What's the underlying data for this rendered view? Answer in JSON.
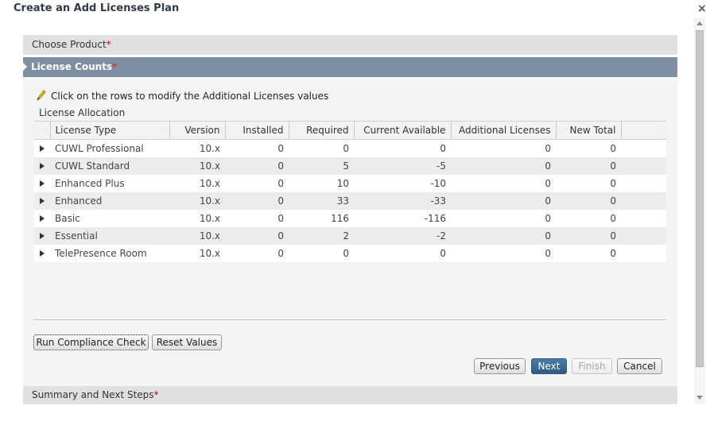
{
  "dialog": {
    "title": "Create an Add Licenses Plan",
    "close_label": "×"
  },
  "sections": {
    "choose_product": "Choose Product",
    "license_counts": "License Counts",
    "summary": "Summary and Next Steps",
    "required_marker": "*"
  },
  "panel": {
    "hint": "Click on the rows to modify the Additional Licenses values",
    "allocation_title": "License Allocation"
  },
  "table": {
    "columns": [
      "License Type",
      "Version",
      "Installed",
      "Required",
      "Current Available",
      "Additional Licenses",
      "New Total"
    ],
    "rows": [
      {
        "type": "CUWL Professional",
        "version": "10.x",
        "installed": "0",
        "required": "0",
        "available": "0",
        "additional": "0",
        "total": "0"
      },
      {
        "type": "CUWL Standard",
        "version": "10.x",
        "installed": "0",
        "required": "5",
        "available": "-5",
        "additional": "0",
        "total": "0"
      },
      {
        "type": "Enhanced Plus",
        "version": "10.x",
        "installed": "0",
        "required": "10",
        "available": "-10",
        "additional": "0",
        "total": "0"
      },
      {
        "type": "Enhanced",
        "version": "10.x",
        "installed": "0",
        "required": "33",
        "available": "-33",
        "additional": "0",
        "total": "0"
      },
      {
        "type": "Basic",
        "version": "10.x",
        "installed": "0",
        "required": "116",
        "available": "-116",
        "additional": "0",
        "total": "0"
      },
      {
        "type": "Essential",
        "version": "10.x",
        "installed": "0",
        "required": "2",
        "available": "-2",
        "additional": "0",
        "total": "0"
      },
      {
        "type": "TelePresence Room",
        "version": "10.x",
        "installed": "0",
        "required": "0",
        "available": "0",
        "additional": "0",
        "total": "0"
      }
    ]
  },
  "buttons": {
    "run_compliance": "Run Compliance Check",
    "reset": "Reset Values",
    "previous": "Previous",
    "next": "Next",
    "finish": "Finish",
    "cancel": "Cancel"
  },
  "colors": {
    "negative": "#cc0000",
    "active_section": "#7f8fa3",
    "primary_button": "#2f5b87"
  }
}
